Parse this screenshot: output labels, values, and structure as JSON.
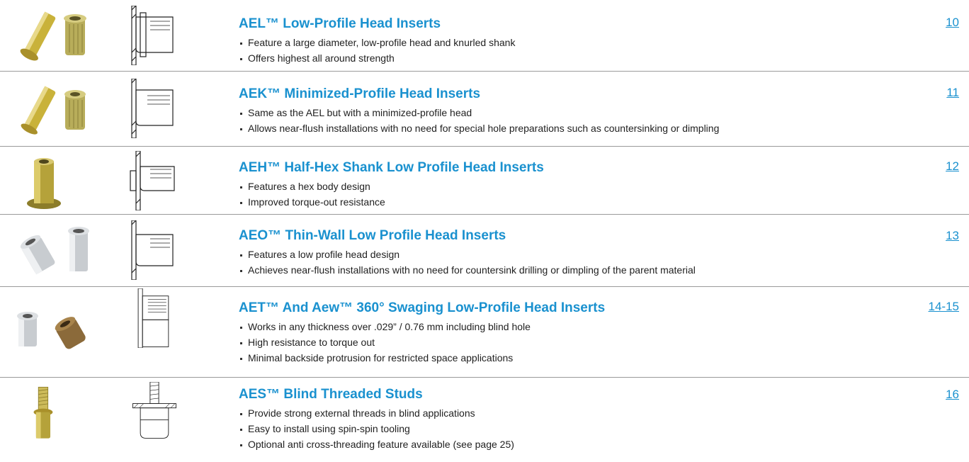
{
  "colors": {
    "accent": "#1a91cf",
    "divider": "#9a9a9a",
    "text": "#1f1f1f",
    "brass": "#c9b23a",
    "zinc": "#c8ccd0"
  },
  "products": [
    {
      "title": "AEL™ Low-Profile Head Inserts",
      "page": "10",
      "bullets": [
        "Feature a large diameter, low-profile head and knurled shank",
        "Offers highest all around strength"
      ]
    },
    {
      "title": "AEK™ Minimized-Profile Head Inserts",
      "page": "11",
      "bullets": [
        "Same as the AEL but with a minimized-profile head",
        "Allows near-flush installations with no need for special hole preparations such as countersinking or dimpling"
      ]
    },
    {
      "title": "AEH™ Half-Hex Shank Low Profile Head Inserts",
      "page": "12",
      "bullets": [
        "Features a hex body design",
        "Improved torque-out resistance"
      ]
    },
    {
      "title": "AEO™ Thin-Wall Low Profile Head Inserts",
      "page": "13",
      "bullets": [
        "Features a low profile head design",
        "Achieves near-flush installations with no need for countersink drilling or dimpling of the parent material"
      ]
    },
    {
      "title": "AET™ And Aew™ 360° Swaging Low-Profile Head Inserts",
      "page": "14-15",
      "bullets": [
        "Works in any thickness over .029” / 0.76 mm including blind hole",
        "High resistance to torque out",
        "Minimal backside protrusion for restricted space applications"
      ]
    },
    {
      "title": "AES™ Blind Threaded Studs",
      "page": "16",
      "bullets": [
        "Provide strong external threads in blind applications",
        "Easy to install using spin-spin tooling",
        "Optional anti cross-threading feature available (see page 25)"
      ]
    }
  ]
}
